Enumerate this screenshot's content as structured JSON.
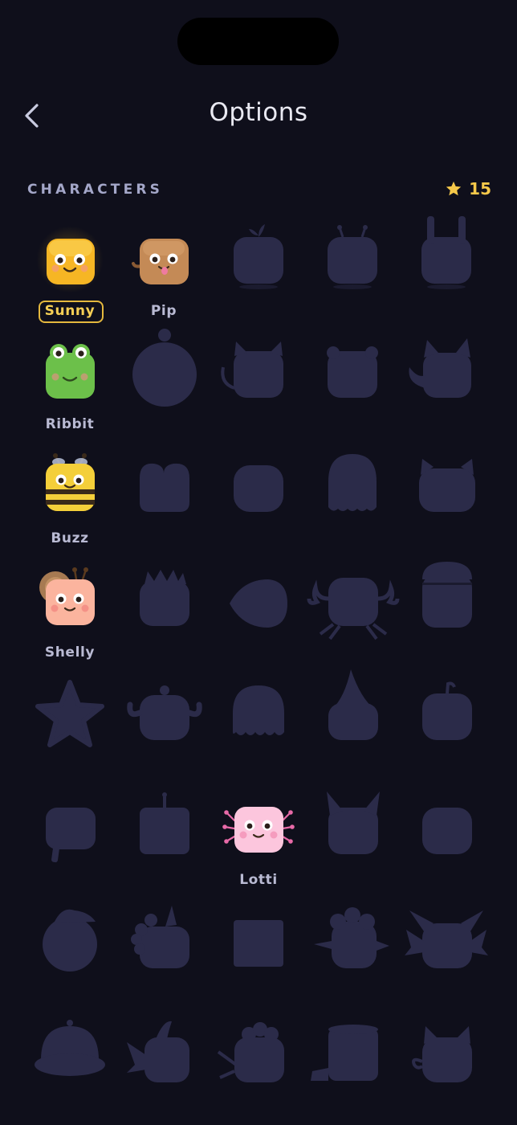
{
  "header": {
    "title": "Options",
    "back_icon": "chevron-left-icon"
  },
  "characters": {
    "section_label": "CHARACTERS",
    "stars": {
      "icon": "star-icon",
      "count": "15",
      "color": "#f5c84a"
    },
    "selected": "Sunny",
    "unlocked_names": {
      "sunny": "Sunny",
      "pip": "Pip",
      "ribbit": "Ribbit",
      "buzz": "Buzz",
      "shelly": "Shelly",
      "lotti": "Lotti"
    },
    "colors": {
      "locked_silhouette": "#2b2b49",
      "background": "#0f0f1b",
      "selected_outline": "#e4b83e"
    }
  }
}
